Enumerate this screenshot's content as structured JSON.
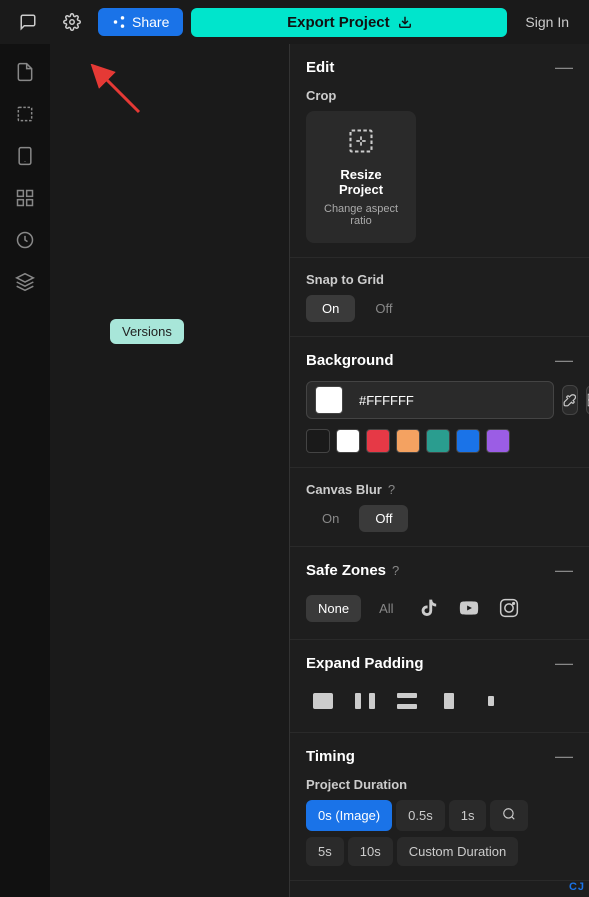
{
  "header": {
    "share_label": "Share",
    "export_label": "Export Project",
    "signin_label": "Sign In"
  },
  "sidebar": {
    "icons": [
      {
        "name": "document-icon",
        "glyph": "📄"
      },
      {
        "name": "crop-icon",
        "glyph": "⬜"
      },
      {
        "name": "mobile-icon",
        "glyph": "📱"
      },
      {
        "name": "grid-icon",
        "glyph": "⊞"
      },
      {
        "name": "clock-icon",
        "glyph": "🕐"
      },
      {
        "name": "layers-icon",
        "glyph": "◈"
      }
    ]
  },
  "versions_badge": "Versions",
  "panel": {
    "edit_section": {
      "title": "Edit",
      "crop_label": "Crop",
      "resize_card": {
        "title": "Resize Project",
        "subtitle": "Change aspect ratio"
      }
    },
    "snap_to_grid": {
      "label": "Snap to Grid",
      "on": "On",
      "off": "Off",
      "active": "on"
    },
    "background_section": {
      "title": "Background",
      "hex_value": "#FFFFFF",
      "swatches": [
        "#1a1a1a",
        "#ffffff",
        "#e63946",
        "#f4a261",
        "#2a9d8f",
        "#1a73e8",
        "#9b5de5"
      ]
    },
    "canvas_blur": {
      "label": "Canvas Blur",
      "on": "On",
      "off": "Off",
      "active": "off"
    },
    "safe_zones": {
      "title": "Safe Zones",
      "none": "None",
      "all": "All",
      "active": "none"
    },
    "expand_padding": {
      "title": "Expand Padding"
    },
    "timing": {
      "title": "Timing",
      "project_duration_label": "Project Duration",
      "durations": [
        "0s (Image)",
        "0.5s",
        "1s",
        "🔍",
        "5s",
        "10s",
        "Custom Duration"
      ],
      "active": "0s (Image)"
    }
  },
  "watermark": "CJ"
}
